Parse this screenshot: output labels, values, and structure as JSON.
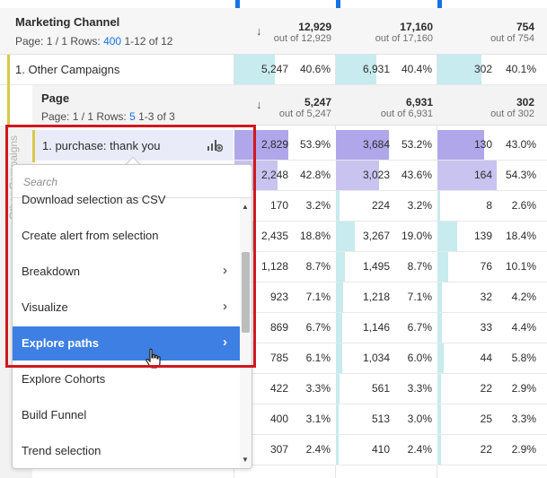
{
  "colors": {
    "accent_yellow": "#d8c94a",
    "bar_teal": "#c7ebee",
    "bar_purple": "#c9c3f0",
    "bar_purple_dark": "#b0a6ea",
    "link_blue": "#1473e6",
    "menu_active": "#3d7fe3",
    "highlight_red": "#d0181e"
  },
  "header": {
    "title": "Marketing Channel",
    "pagination_prefix": "Page: 1 / 1  Rows:",
    "rows_per_page": "400",
    "range": "1-12 of 12",
    "sort_icon": "arrow-down-icon",
    "metrics": [
      {
        "value": "12,929",
        "out_of": "out of 12,929"
      },
      {
        "value": "17,160",
        "out_of": "out of 17,160"
      },
      {
        "value": "754",
        "out_of": "out of 754"
      }
    ]
  },
  "row1": {
    "label": "1.  Other Campaigns",
    "cells": [
      {
        "value": "5,247",
        "pct": "40.6%",
        "fraction": 0.406
      },
      {
        "value": "6,931",
        "pct": "40.4%",
        "fraction": 0.404
      },
      {
        "value": "302",
        "pct": "40.1%",
        "fraction": 0.401
      }
    ]
  },
  "subheader": {
    "title": "Page",
    "pagination_prefix": "Page: 1 / 1  Rows:",
    "rows_per_page": "5",
    "range": "1-3 of 3",
    "metrics": [
      {
        "value": "5,247",
        "out_of": "out of 5,247"
      },
      {
        "value": "6,931",
        "out_of": "out of 6,931"
      },
      {
        "value": "302",
        "out_of": "out of 302"
      }
    ]
  },
  "vertical_label": "Other Campaigns",
  "selected_row": {
    "label": "1.  purchase: thank you",
    "icon": "breakdown-icon"
  },
  "rows": [
    {
      "cells": [
        {
          "value": "2,829",
          "pct": "53.9%",
          "fraction": 0.539
        },
        {
          "value": "3,684",
          "pct": "53.2%",
          "fraction": 0.532
        },
        {
          "value": "130",
          "pct": "43.0%",
          "fraction": 0.43
        }
      ]
    },
    {
      "cells": [
        {
          "value": "2,248",
          "pct": "42.8%",
          "fraction": 0.428
        },
        {
          "value": "3,023",
          "pct": "43.6%",
          "fraction": 0.436
        },
        {
          "value": "164",
          "pct": "54.3%",
          "fraction": 0.543
        }
      ]
    },
    {
      "cells": [
        {
          "value": "170",
          "pct": "3.2%",
          "fraction": 0.032
        },
        {
          "value": "224",
          "pct": "3.2%",
          "fraction": 0.032
        },
        {
          "value": "8",
          "pct": "2.6%",
          "fraction": 0.026
        }
      ]
    },
    {
      "cells": [
        {
          "value": "2,435",
          "pct": "18.8%",
          "fraction": 0.188
        },
        {
          "value": "3,267",
          "pct": "19.0%",
          "fraction": 0.19
        },
        {
          "value": "139",
          "pct": "18.4%",
          "fraction": 0.184
        }
      ]
    },
    {
      "cells": [
        {
          "value": "1,128",
          "pct": "8.7%",
          "fraction": 0.087
        },
        {
          "value": "1,495",
          "pct": "8.7%",
          "fraction": 0.087
        },
        {
          "value": "76",
          "pct": "10.1%",
          "fraction": 0.101
        }
      ]
    },
    {
      "cells": [
        {
          "value": "923",
          "pct": "7.1%",
          "fraction": 0.071
        },
        {
          "value": "1,218",
          "pct": "7.1%",
          "fraction": 0.071
        },
        {
          "value": "32",
          "pct": "4.2%",
          "fraction": 0.042
        }
      ]
    },
    {
      "cells": [
        {
          "value": "869",
          "pct": "6.7%",
          "fraction": 0.067
        },
        {
          "value": "1,146",
          "pct": "6.7%",
          "fraction": 0.067
        },
        {
          "value": "33",
          "pct": "4.4%",
          "fraction": 0.044
        }
      ]
    },
    {
      "cells": [
        {
          "value": "785",
          "pct": "6.1%",
          "fraction": 0.061
        },
        {
          "value": "1,034",
          "pct": "6.0%",
          "fraction": 0.06
        },
        {
          "value": "44",
          "pct": "5.8%",
          "fraction": 0.058
        }
      ]
    },
    {
      "cells": [
        {
          "value": "422",
          "pct": "3.3%",
          "fraction": 0.033
        },
        {
          "value": "561",
          "pct": "3.3%",
          "fraction": 0.033
        },
        {
          "value": "22",
          "pct": "2.9%",
          "fraction": 0.029
        }
      ]
    },
    {
      "cells": [
        {
          "value": "400",
          "pct": "3.1%",
          "fraction": 0.031
        },
        {
          "value": "513",
          "pct": "3.0%",
          "fraction": 0.03
        },
        {
          "value": "25",
          "pct": "3.3%",
          "fraction": 0.033
        }
      ]
    },
    {
      "cells": [
        {
          "value": "307",
          "pct": "2.4%",
          "fraction": 0.024
        },
        {
          "value": "410",
          "pct": "2.4%",
          "fraction": 0.024
        },
        {
          "value": "22",
          "pct": "2.9%",
          "fraction": 0.029
        }
      ]
    }
  ],
  "menu": {
    "search_placeholder": "Search",
    "items": [
      {
        "label": "Download selection as CSV",
        "submenu": false
      },
      {
        "label": "Create alert from selection",
        "submenu": false
      },
      {
        "label": "Breakdown",
        "submenu": true
      },
      {
        "label": "Visualize",
        "submenu": true
      },
      {
        "label": "Explore paths",
        "submenu": true,
        "active": true
      },
      {
        "label": "Explore Cohorts",
        "submenu": false
      },
      {
        "label": "Build Funnel",
        "submenu": false
      },
      {
        "label": "Trend selection",
        "submenu": false
      }
    ],
    "chevron_icon": "chevron-right-icon",
    "scroll_up_icon": "triangle-up-icon",
    "scroll_down_icon": "triangle-down-icon",
    "cursor_icon": "hand-pointer-icon"
  }
}
